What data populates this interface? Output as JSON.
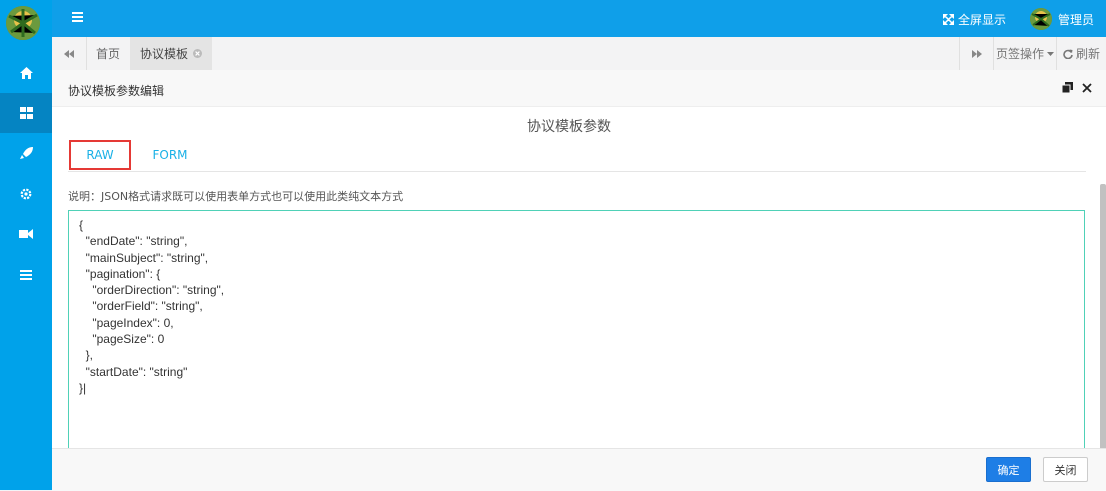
{
  "topbar": {
    "fullscreen_label": "全屏显示",
    "user_name": "管理员"
  },
  "tabs": {
    "items": [
      {
        "label": "首页"
      },
      {
        "label": "协议模板"
      }
    ],
    "page_ops_label": "页签操作",
    "refresh_label": "刷新"
  },
  "dialog": {
    "title": "协议模板参数编辑",
    "form_title": "协议模板参数",
    "param_tabs": [
      "RAW",
      "FORM"
    ],
    "note": "说明：JSON格式请求既可以使用表单方式也可以使用此类纯文本方式",
    "editor_value": "{\n  \"endDate\": \"string\",\n  \"mainSubject\": \"string\",\n  \"pagination\": {\n    \"orderDirection\": \"string\",\n    \"orderField\": \"string\",\n    \"pageIndex\": 0,\n    \"pageSize\": 0\n  },\n  \"startDate\": \"string\"\n}|",
    "confirm_label": "确定",
    "close_label": "关闭"
  },
  "colors": {
    "sidebar": "#00a2ea",
    "topbar": "#0f9fe9",
    "accent": "#1ab1e6",
    "primary_button": "#1e7ee6",
    "highlight": "#e53935",
    "editor_border": "#4fd1b7"
  },
  "icons": [
    "hamburger-icon",
    "home-icon",
    "grid-icon",
    "rocket-icon",
    "gear-icon",
    "video-icon",
    "list-icon",
    "fullscreen-icon",
    "backward-icon",
    "forward-icon",
    "close-circle-icon",
    "caret-down-icon",
    "refresh-icon",
    "maximize-icon",
    "close-icon"
  ]
}
